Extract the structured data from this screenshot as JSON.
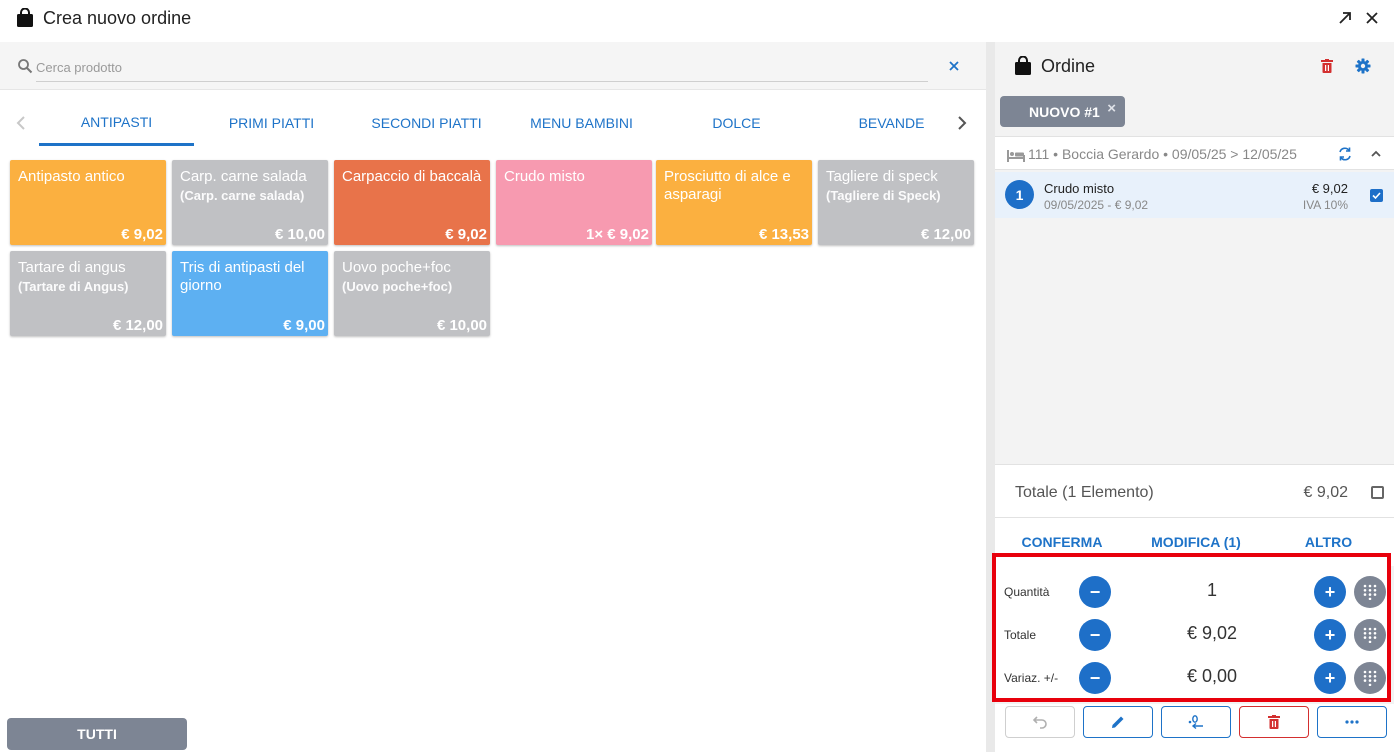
{
  "window": {
    "title": "Crea nuovo ordine"
  },
  "search": {
    "placeholder": "Cerca prodotto",
    "value": ""
  },
  "categories": [
    "ANTIPASTI",
    "PRIMI PIATTI",
    "SECONDI PIATTI",
    "MENU BAMBINI",
    "DOLCE",
    "BEVANDE"
  ],
  "active_category": "ANTIPASTI",
  "products": [
    {
      "name": "Antipasto antico",
      "sub": "",
      "price": "€ 9,02",
      "color": "#fbb040"
    },
    {
      "name": "Carp. carne salada",
      "sub": "(Carp. carne salada)",
      "price": "€ 10,00",
      "color": "#c0c1c4"
    },
    {
      "name": "Carpaccio di baccalà",
      "sub": "",
      "price": "€ 9,02",
      "color": "#e8734a"
    },
    {
      "name": "Crudo misto",
      "sub": "",
      "price": "1× € 9,02",
      "color": "#f79ab0"
    },
    {
      "name": "Prosciutto di alce e asparagi",
      "sub": "",
      "price": "€ 13,53",
      "color": "#fbb040"
    },
    {
      "name": "Tagliere di speck",
      "sub": "(Tagliere di Speck)",
      "price": "€ 12,00",
      "color": "#c0c1c4"
    },
    {
      "name": "Tartare di angus",
      "sub": "(Tartare di Angus)",
      "price": "€ 12,00",
      "color": "#c0c1c4"
    },
    {
      "name": "Tris di antipasti del giorno",
      "sub": "",
      "price": "€ 9,00",
      "color": "#5db0f2"
    },
    {
      "name": "Uovo poche+foc",
      "sub": "(Uovo poche+foc)",
      "price": "€ 10,00",
      "color": "#c0c1c4"
    }
  ],
  "filter_button": "TUTTI",
  "order": {
    "title": "Ordine",
    "chip": "NUOVO #1",
    "chip_close": "×",
    "info": "111 • Boccia Gerardo • 09/05/25 > 12/05/25",
    "items": [
      {
        "index": "1",
        "name": "Crudo misto",
        "detail": "09/05/2025 - € 9,02",
        "price": "€ 9,02",
        "vat": "IVA 10%",
        "checked": true
      }
    ],
    "total_label": "Totale (1 Elemento)",
    "total_value": "€ 9,02"
  },
  "action_tabs": [
    "CONFERMA",
    "MODIFICA (1)",
    "ALTRO"
  ],
  "active_action_tab": "MODIFICA (1)",
  "edit": {
    "rows": [
      {
        "label": "Quantità",
        "value": "1"
      },
      {
        "label": "Totale",
        "value": "€ 9,02"
      },
      {
        "label": "Variaz. +/-",
        "value": "€ 0,00"
      }
    ],
    "minus": "−",
    "plus": "+"
  },
  "colors": {
    "accent": "#1e73c8",
    "danger": "#d32f2f",
    "highlight_border": "#e8000c",
    "neutral_button": "#7d8594"
  },
  "icons": {
    "topbar": [
      "shopping-bag-icon",
      "open-external-icon",
      "close-icon"
    ],
    "order_header": [
      "delete-icon",
      "settings-icon"
    ],
    "bottom_buttons": [
      "undo-icon",
      "edit-icon",
      "decimal-icon",
      "delete-icon",
      "more-icon"
    ]
  }
}
